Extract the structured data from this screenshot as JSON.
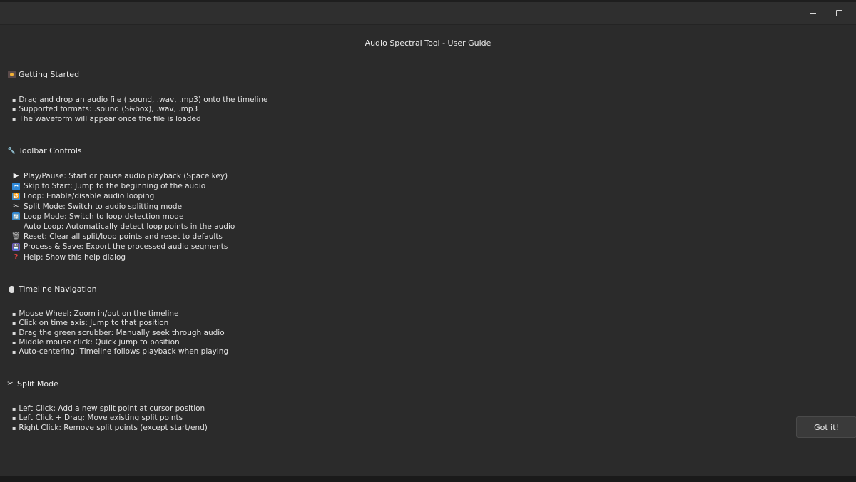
{
  "window": {
    "minimize_icon": "minimize-icon",
    "maximize_icon": "maximize-icon"
  },
  "dialog": {
    "title": "Audio Spectral Tool - User Guide",
    "button_label": "Got it!"
  },
  "sections": {
    "getting_started": {
      "heading": "Getting Started",
      "icon": "record-icon",
      "items": [
        "Drag and drop an audio file (.sound, .wav, .mp3) onto the timeline",
        "Supported formats: .sound (S&box), .wav, .mp3",
        "The waveform will appear once the file is loaded"
      ]
    },
    "toolbar_controls": {
      "heading": "Toolbar Controls",
      "icon": "wrench-icon",
      "items": [
        {
          "icon": "play-icon",
          "glyph": "▶",
          "text": "Play/Pause: Start or pause audio playback (Space key)"
        },
        {
          "icon": "skip-start-icon",
          "glyph": "⏮",
          "text": "Skip to Start: Jump to the beginning of the audio"
        },
        {
          "icon": "loop-icon",
          "glyph": "🔁",
          "text": "Loop: Enable/disable audio looping"
        },
        {
          "icon": "scissors-icon",
          "glyph": "✂",
          "text": "Split Mode: Switch to audio splitting mode"
        },
        {
          "icon": "loop-mode-icon",
          "glyph": "🔄",
          "text": "Loop Mode: Switch to loop detection mode"
        },
        {
          "icon": "auto-loop-icon",
          "glyph": "",
          "text": "Auto Loop: Automatically detect loop points in the audio"
        },
        {
          "icon": "trash-icon",
          "glyph": "🗑",
          "text": "Reset: Clear all split/loop points and reset to defaults"
        },
        {
          "icon": "save-icon",
          "glyph": "💾",
          "text": "Process & Save: Export the processed audio segments"
        },
        {
          "icon": "help-icon",
          "glyph": "?",
          "text": "Help: Show this help dialog"
        }
      ]
    },
    "timeline_navigation": {
      "heading": "Timeline Navigation",
      "icon": "mouse-icon",
      "items": [
        "Mouse Wheel: Zoom in/out on the timeline",
        "Click on time axis: Jump to that position",
        "Drag the green scrubber: Manually seek through audio",
        "Middle mouse click: Quick jump to position",
        "Auto-centering: Timeline follows playback when playing"
      ]
    },
    "split_mode": {
      "heading": "Split Mode",
      "icon": "scissors-icon",
      "items": [
        "Left Click: Add a new split point at cursor position",
        "Left Click + Drag: Move existing split points",
        "Right Click: Remove split points (except start/end)"
      ]
    }
  }
}
